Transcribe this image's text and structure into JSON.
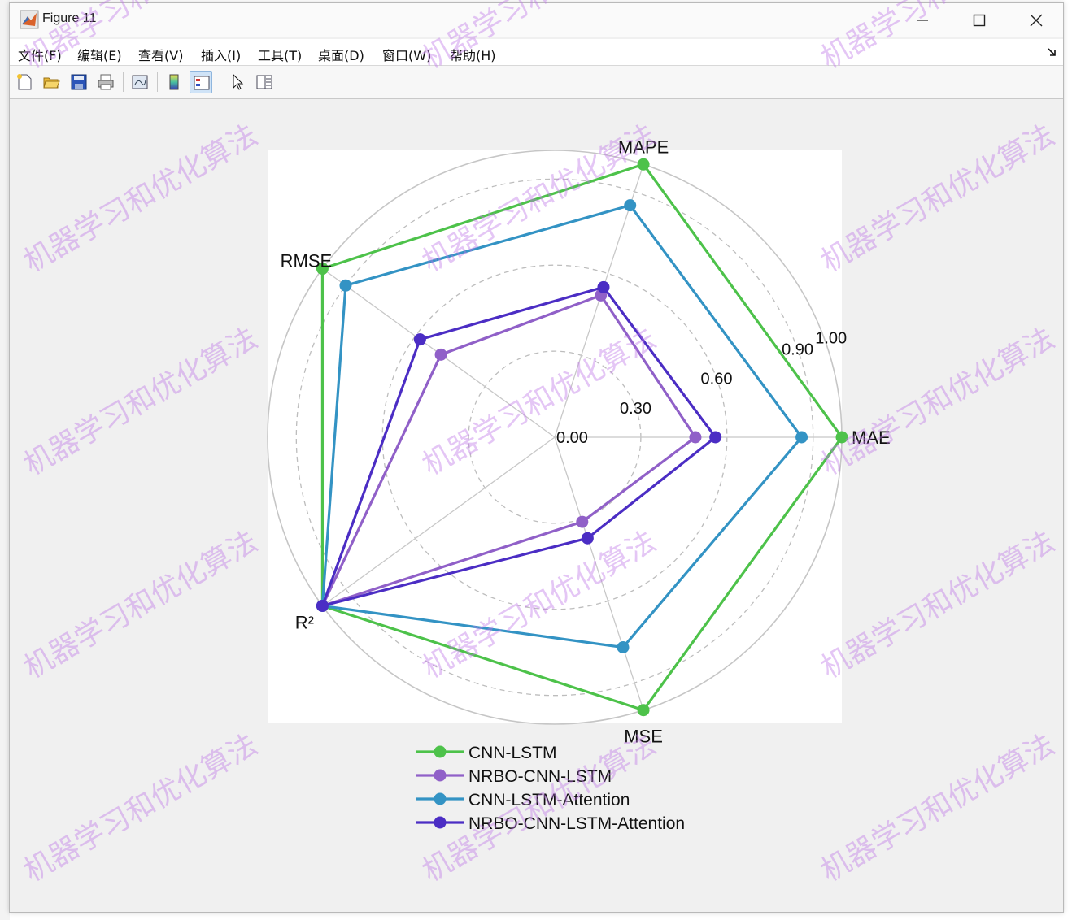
{
  "window": {
    "title": "Figure 11",
    "menu": [
      "文件(F)",
      "编辑(E)",
      "查看(V)",
      "插入(I)",
      "工具(T)",
      "桌面(D)",
      "窗口(W)",
      "帮助(H)"
    ],
    "toolbar_icons": [
      "new-figure-icon",
      "open-file-icon",
      "save-icon",
      "print-icon",
      "link-plot-icon",
      "insert-colorbar-icon",
      "insert-legend-icon",
      "edit-plot-icon",
      "property-inspector-icon"
    ]
  },
  "watermark": "机器学习和优化算法",
  "colors": {
    "CNN-LSTM": "#4dc24a",
    "NRBO-CNN-LSTM": "#9060c8",
    "CNN-LSTM-Attention": "#3393c4",
    "NRBO-CNN-LSTM-Attention": "#4b2dc4"
  },
  "chart_data": {
    "type": "radar",
    "axes": [
      "MAE",
      "MAPE",
      "RMSE",
      "R²",
      "MSE"
    ],
    "radial_ticks": [
      0.0,
      0.3,
      0.6,
      0.9,
      1.0
    ],
    "radial_tick_labels": [
      "0.00",
      "0.30",
      "0.60",
      "0.90",
      "1.00"
    ],
    "rlim": [
      0,
      1
    ],
    "grid": true,
    "legend_position": "bottom",
    "series": [
      {
        "name": "CNN-LSTM",
        "values": [
          1.0,
          1.0,
          1.0,
          1.0,
          1.0
        ]
      },
      {
        "name": "NRBO-CNN-LSTM",
        "values": [
          0.49,
          0.52,
          0.49,
          1.0,
          0.31
        ]
      },
      {
        "name": "CNN-LSTM-Attention",
        "values": [
          0.86,
          0.85,
          0.9,
          1.0,
          0.77
        ]
      },
      {
        "name": "NRBO-CNN-LSTM-Attention",
        "values": [
          0.56,
          0.55,
          0.58,
          1.0,
          0.37
        ]
      }
    ]
  }
}
